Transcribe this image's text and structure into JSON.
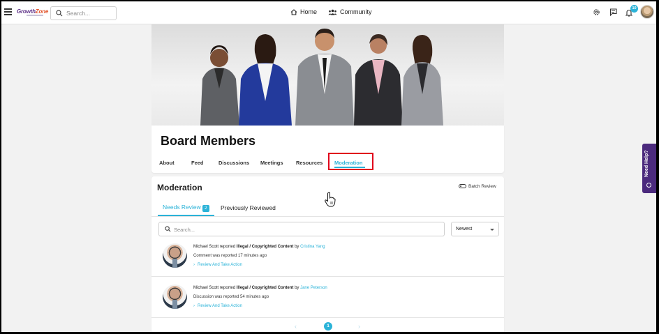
{
  "topbar": {
    "logo_part1": "Growth",
    "logo_part2": "Zone",
    "search_placeholder": "Search...",
    "nav_home": "Home",
    "nav_community": "Community",
    "notification_count": "10"
  },
  "group": {
    "title": "Board Members",
    "tabs": [
      "About",
      "Feed",
      "Discussions",
      "Meetings",
      "Resources",
      "Moderation"
    ],
    "active_tab": "Moderation"
  },
  "moderation": {
    "title": "Moderation",
    "batch_review": "Batch Review",
    "subtabs": {
      "needs_review": "Needs Review",
      "needs_review_count": "2",
      "previously_reviewed": "Previously Reviewed"
    },
    "search_placeholder": "Search...",
    "sort_value": "Newest",
    "reports": [
      {
        "reporter": "Michael Scott",
        "verb": "reported",
        "category": "Illegal / Copyrighted Content",
        "by": "by",
        "author": "Cristina Yang",
        "detail": "Comment was reported 17 minutes ago",
        "action": "Review And Take Action"
      },
      {
        "reporter": "Michael Scott",
        "verb": "reported",
        "category": "Illegal / Copyrighted Content",
        "by": "by",
        "author": "Jane Peterson",
        "detail": "Discussion was reported 54 minutes ago",
        "action": "Review And Take Action"
      }
    ],
    "pagination": {
      "current_page": "1",
      "prev": "‹",
      "next": "›"
    }
  },
  "need_help": "Need Help?",
  "colors": {
    "accent": "#2bb3d8",
    "brand_purple": "#4b2a7d",
    "highlight_red": "#e0001b"
  }
}
